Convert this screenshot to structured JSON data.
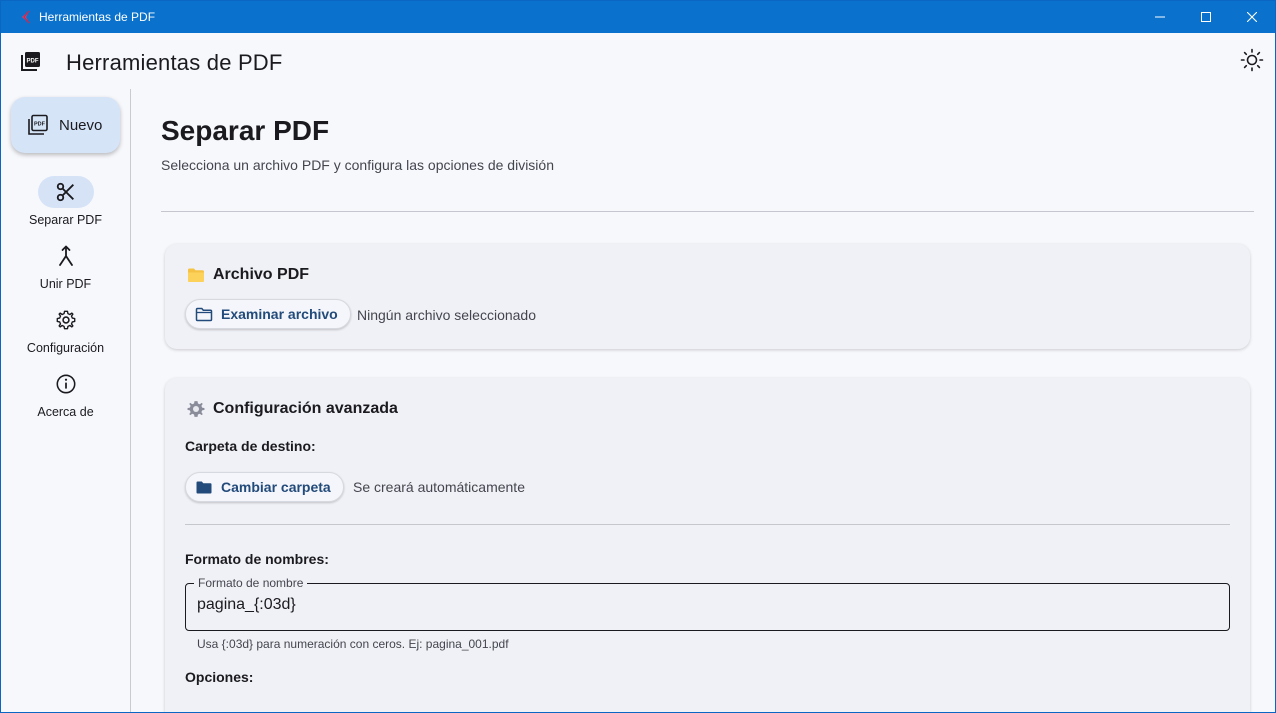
{
  "window": {
    "title": "Herramientas de PDF"
  },
  "appbar": {
    "title": "Herramientas de PDF",
    "logo_icon": "pdf-stack-icon",
    "theme_icon": "sun-icon"
  },
  "rail": {
    "fab_label": "Nuevo",
    "items": [
      {
        "label": "Separar PDF",
        "icon": "scissors-icon",
        "active": true
      },
      {
        "label": "Unir PDF",
        "icon": "merge-icon",
        "active": false
      },
      {
        "label": "Configuración",
        "icon": "gear-icon",
        "active": false
      },
      {
        "label": "Acerca de",
        "icon": "info-icon",
        "active": false
      }
    ]
  },
  "page": {
    "title": "Separar PDF",
    "subtitle": "Selecciona un archivo PDF y configura las opciones de división"
  },
  "file_card": {
    "title": "Archivo PDF",
    "browse_label": "Examinar archivo",
    "status": "Ningún archivo seleccionado"
  },
  "advanced_card": {
    "title": "Configuración avanzada",
    "dest_label": "Carpeta de destino:",
    "change_folder_label": "Cambiar carpeta",
    "dest_status": "Se creará automáticamente",
    "naming_label": "Formato de nombres:",
    "naming_field_label": "Formato de nombre",
    "naming_field_value": "pagina_{:03d}",
    "naming_helper": "Usa {:03d} para numeración con ceros. Ej: pagina_001.pdf",
    "options_label": "Opciones:"
  },
  "colors": {
    "titlebar": "#0a72cc",
    "accent": "#224a7a",
    "rail_active": "#d6e3f7",
    "folder_yellow": "#f6c244"
  }
}
